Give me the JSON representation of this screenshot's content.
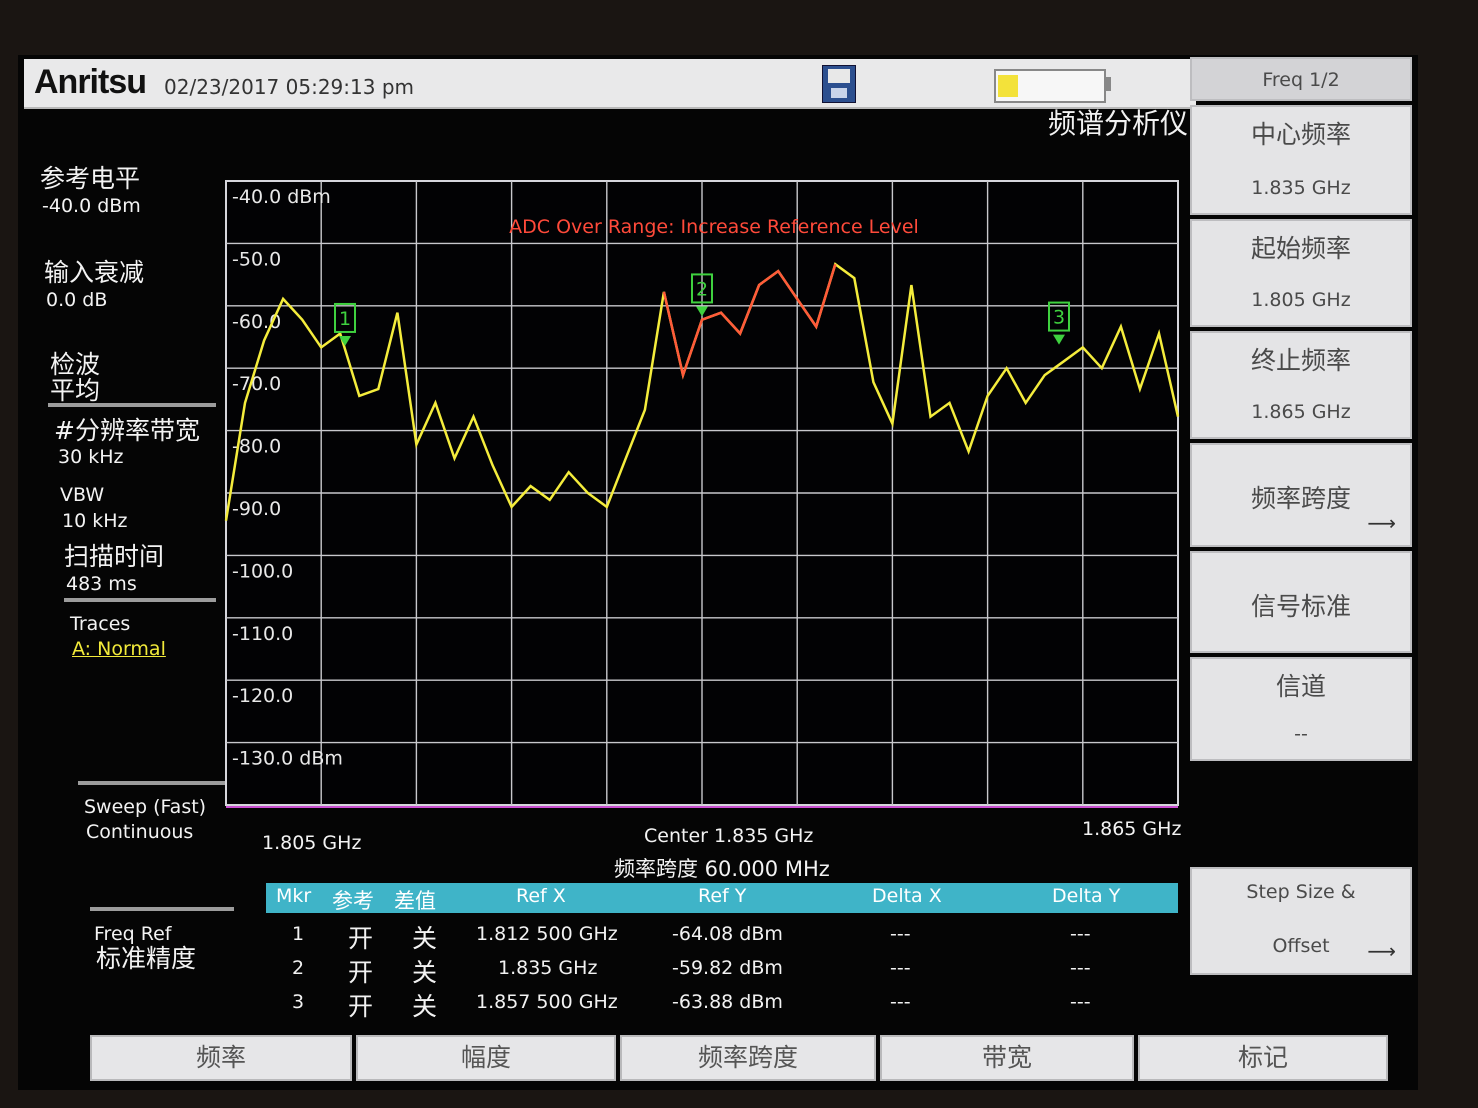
{
  "header": {
    "brand": "Anritsu",
    "datetime": "02/23/2017 05:29:13 pm",
    "mode": "频谱分析仪"
  },
  "left_panel": {
    "ref_level_label": "参考电平",
    "ref_level_value": "-40.0 dBm",
    "atten_label": "输入衰减",
    "atten_value": "0.0 dB",
    "detect_label_1": "检波",
    "detect_label_2": "平均",
    "rbw_label": "#分辨率带宽",
    "rbw_value": "30 kHz",
    "vbw_label": "VBW",
    "vbw_value": "10 kHz",
    "sweep_time_label": "扫描时间",
    "sweep_time_value": "483 ms",
    "traces_label": "Traces",
    "traces_value": "A: Normal",
    "sweep_mode_1": "Sweep (Fast)",
    "sweep_mode_2": "Continuous",
    "freq_ref_1": "Freq Ref",
    "freq_ref_2": "标准精度"
  },
  "graph": {
    "warning": "ADC Over Range: Increase Reference Level",
    "y_labels": [
      "-40.0 dBm",
      "-50.0",
      "-60.0",
      "-70.0",
      "-80.0",
      "-90.0",
      "-100.0",
      "-110.0",
      "-120.0",
      "-130.0 dBm"
    ],
    "start_freq": "1.805 GHz",
    "center": "Center 1.835 GHz",
    "stop_freq": "1.865 GHz",
    "span": "频率跨度 60.000 MHz",
    "colors": {
      "trace": "#f4ec3c",
      "over_range": "#ff5a3a",
      "marker": "#3fd13f",
      "grid": "#c8c8cc"
    }
  },
  "chart_data": {
    "type": "line",
    "x_unit": "GHz",
    "y_unit": "dBm",
    "xlim": [
      1.805,
      1.865
    ],
    "ylim": [
      -130,
      -40
    ],
    "grid": true,
    "x": [
      1.805,
      1.8062,
      1.8074,
      1.8086,
      1.8098,
      1.811,
      1.8122,
      1.8134,
      1.8146,
      1.8158,
      1.817,
      1.8182,
      1.8194,
      1.8206,
      1.8218,
      1.823,
      1.8242,
      1.8254,
      1.8266,
      1.8278,
      1.829,
      1.8302,
      1.8314,
      1.8326,
      1.8338,
      1.835,
      1.8362,
      1.8374,
      1.8386,
      1.8398,
      1.841,
      1.8422,
      1.8434,
      1.8446,
      1.8458,
      1.847,
      1.8482,
      1.8494,
      1.8506,
      1.8518,
      1.853,
      1.8542,
      1.8554,
      1.8566,
      1.8578,
      1.859,
      1.8602,
      1.8614,
      1.8626,
      1.8638,
      1.865
    ],
    "values": [
      -89,
      -72,
      -63,
      -57,
      -60,
      -64,
      -62,
      -71,
      -70,
      -59,
      -78,
      -72,
      -80,
      -74,
      -81,
      -87,
      -84,
      -86,
      -82,
      -85,
      -87,
      -80,
      -73,
      -56,
      -68,
      -60,
      -59,
      -62,
      -55,
      -53,
      -57,
      -61,
      -52,
      -54,
      -69,
      -75,
      -55,
      -74,
      -72,
      -79,
      -71,
      -67,
      -72,
      -68,
      -66,
      -64,
      -67,
      -61,
      -70,
      -62,
      -74
    ],
    "markers": [
      {
        "id": "1",
        "freq": 1.8125,
        "level": -64.08
      },
      {
        "id": "2",
        "freq": 1.835,
        "level": -59.82
      },
      {
        "id": "3",
        "freq": 1.8575,
        "level": -63.88
      }
    ]
  },
  "marker_table": {
    "headers": [
      "Mkr",
      "参考",
      "差值",
      "Ref X",
      "Ref Y",
      "Delta X",
      "Delta Y"
    ],
    "rows": [
      {
        "mkr": "1",
        "ref": "开",
        "delta": "关",
        "x": "1.812 500 GHz",
        "y": "-64.08 dBm",
        "dx": "---",
        "dy": "---"
      },
      {
        "mkr": "2",
        "ref": "开",
        "delta": "关",
        "x": "1.835 GHz",
        "y": "-59.82 dBm",
        "dx": "---",
        "dy": "---"
      },
      {
        "mkr": "3",
        "ref": "开",
        "delta": "关",
        "x": "1.857 500 GHz",
        "y": "-63.88 dBm",
        "dx": "---",
        "dy": "---"
      }
    ]
  },
  "softkeys": {
    "title": "Freq 1/2",
    "center_label": "中心频率",
    "center_value": "1.835 GHz",
    "start_label": "起始频率",
    "start_value": "1.805 GHz",
    "stop_label": "终止频率",
    "stop_value": "1.865 GHz",
    "span_label": "频率跨度",
    "std_label": "信号标准",
    "channel_label": "信道",
    "channel_value": "--",
    "step_label_1": "Step Size &",
    "step_label_2": "Offset",
    "arrow": "⟶"
  },
  "bottom_menu": [
    "频率",
    "幅度",
    "频率跨度",
    "带宽",
    "标记"
  ]
}
